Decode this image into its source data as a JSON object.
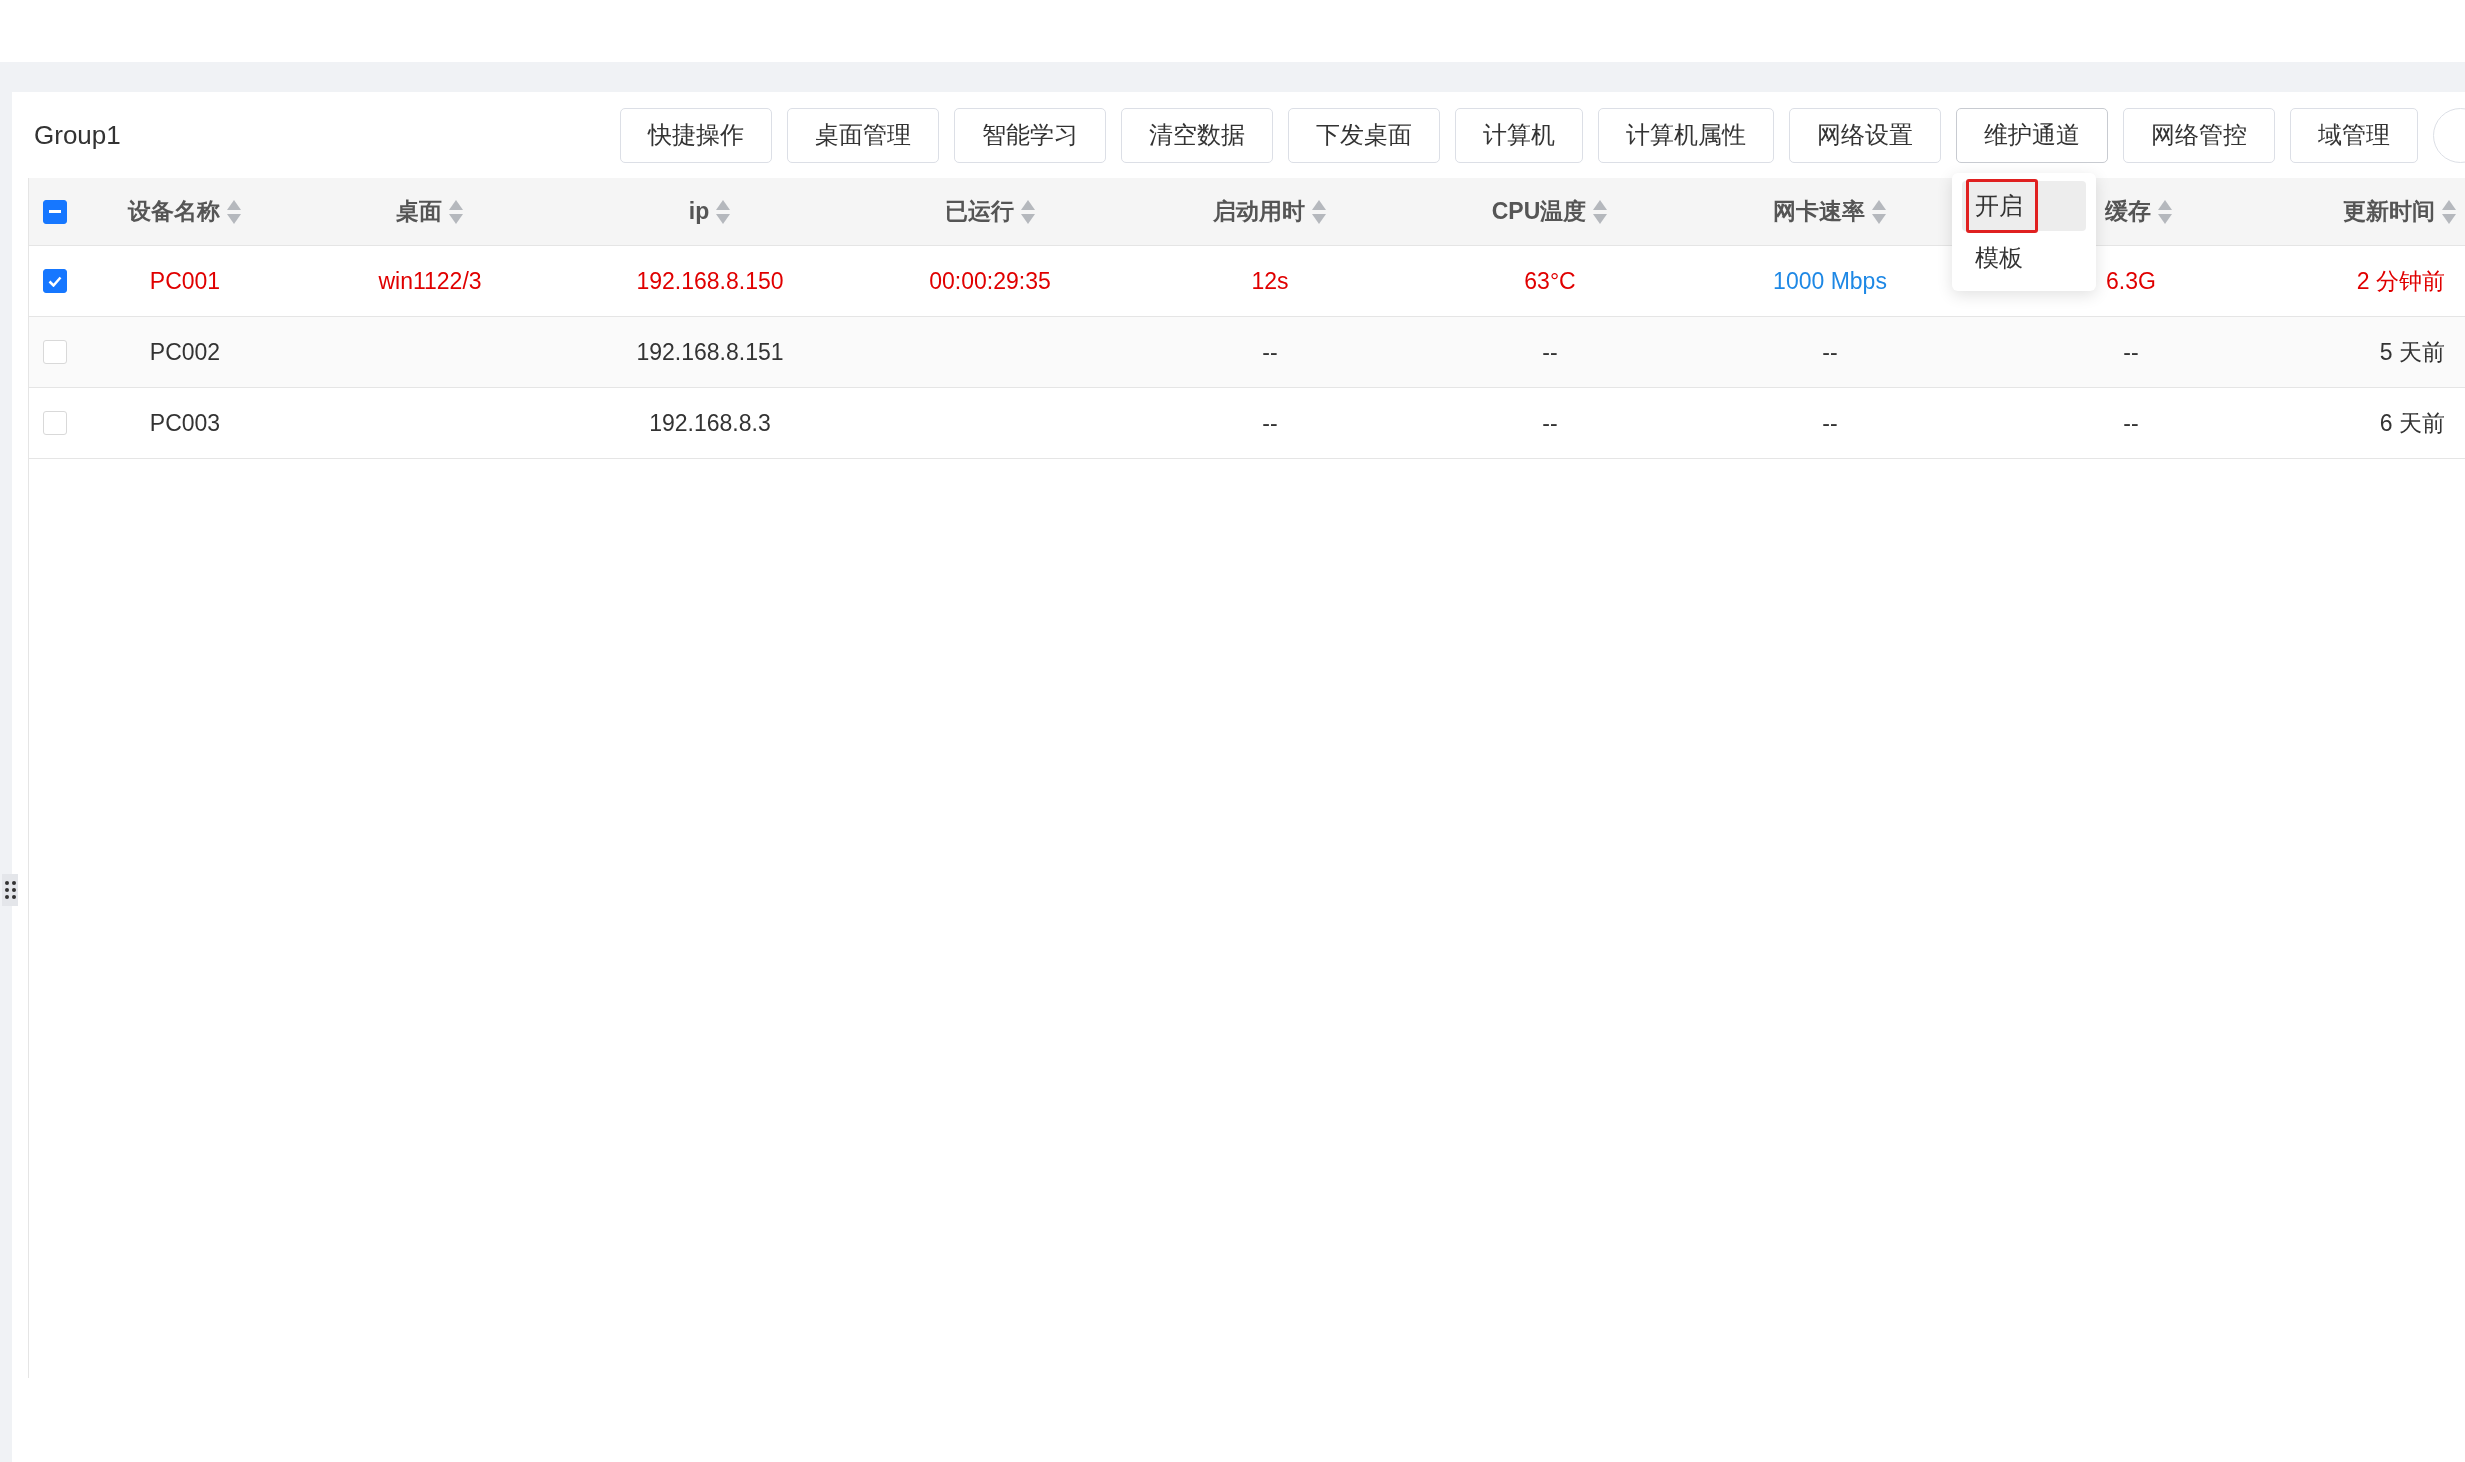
{
  "group_title": "Group1",
  "toolbar": [
    {
      "label": "快捷操作"
    },
    {
      "label": "桌面管理"
    },
    {
      "label": "智能学习"
    },
    {
      "label": "清空数据"
    },
    {
      "label": "下发桌面"
    },
    {
      "label": "计算机"
    },
    {
      "label": "计算机属性"
    },
    {
      "label": "网络设置"
    },
    {
      "label": "维护通道",
      "menu": [
        {
          "label": "开启",
          "selected": true,
          "outlined": true
        },
        {
          "label": "模板",
          "selected": false,
          "outlined": false
        }
      ]
    },
    {
      "label": "网络管控"
    },
    {
      "label": "域管理"
    }
  ],
  "table": {
    "header_checkbox": {
      "indeterminate": true
    },
    "columns": [
      "设备名称",
      "桌面",
      "ip",
      "已运行",
      "启动用时",
      "CPU温度",
      "网卡速率",
      "缓存",
      "更新时间"
    ],
    "rows": [
      {
        "selected": true,
        "cells": [
          {
            "text": "PC001",
            "color": "#e00000"
          },
          {
            "text": "win1122/3",
            "color": "#e00000"
          },
          {
            "text": "192.168.8.150",
            "color": "#e00000"
          },
          {
            "text": "00:00:29:35",
            "color": "#e00000"
          },
          {
            "text": "12s",
            "color": "#e00000"
          },
          {
            "text": "63°C",
            "color": "#e00000"
          },
          {
            "text": "1000 Mbps",
            "color": "#1e88e5"
          },
          {
            "text": "6.3G",
            "color": "#e00000"
          },
          {
            "text": "2 分钟前",
            "color": "#e00000"
          }
        ]
      },
      {
        "selected": false,
        "cells": [
          {
            "text": "PC002",
            "color": "#333333"
          },
          null,
          {
            "text": "192.168.8.151",
            "color": "#333333"
          },
          null,
          {
            "text": "--",
            "color": "#333333"
          },
          {
            "text": "--",
            "color": "#333333"
          },
          {
            "text": "--",
            "color": "#333333"
          },
          {
            "text": "--",
            "color": "#333333"
          },
          {
            "text": "5 天前",
            "color": "#333333"
          }
        ]
      },
      {
        "selected": false,
        "cells": [
          {
            "text": "PC003",
            "color": "#333333"
          },
          null,
          {
            "text": "192.168.8.3",
            "color": "#333333"
          },
          null,
          {
            "text": "--",
            "color": "#333333"
          },
          {
            "text": "--",
            "color": "#333333"
          },
          {
            "text": "--",
            "color": "#333333"
          },
          {
            "text": "--",
            "color": "#333333"
          },
          {
            "text": "6 天前",
            "color": "#333333"
          }
        ]
      }
    ]
  }
}
